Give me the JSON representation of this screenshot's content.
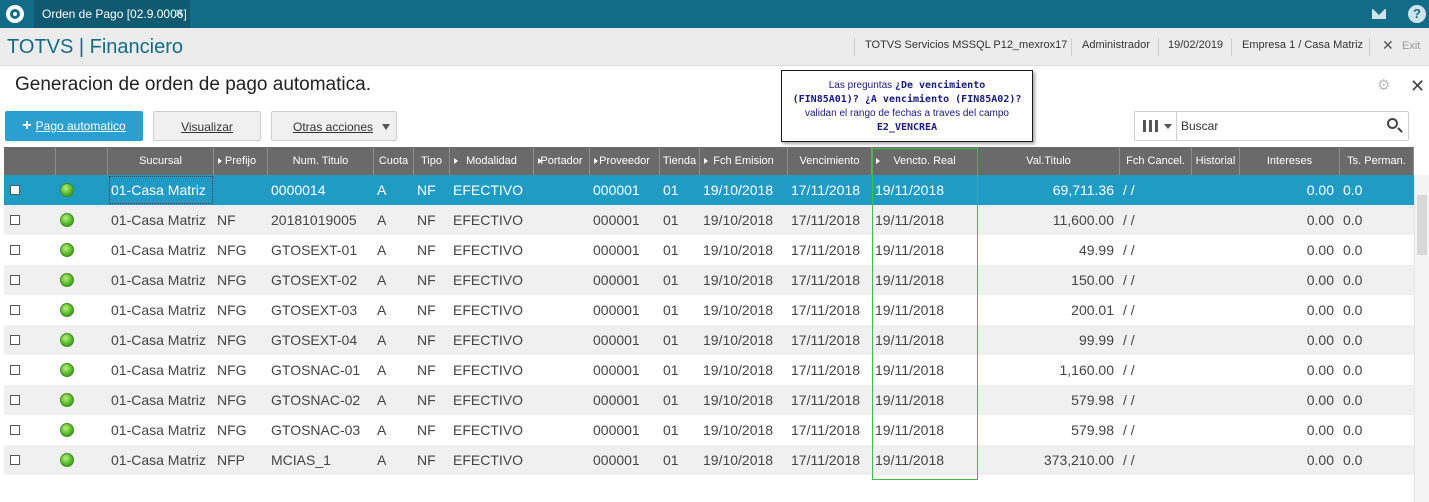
{
  "topbar": {
    "tab_label": "Orden de Pago [02.9.0006]",
    "tab_close": "✕",
    "help_glyph": "?",
    "brand_color": "#136c87"
  },
  "header": {
    "brand": "TOTVS | Financiero",
    "server": "TOTVS Servicios MSSQL P12_mexrox17",
    "user": "Administrador",
    "date": "19/02/2019",
    "company": "Empresa 1 / Casa Matriz",
    "exit_label": "Exit",
    "exit_glyph": "✕"
  },
  "page": {
    "title": "Generacion de orden de pago automatica.",
    "gear_glyph": "⚙",
    "close_glyph": "✕"
  },
  "toolbar": {
    "primary_plus": "+",
    "primary_label": "Pago automatico",
    "visualizar_label": "Visualizar",
    "otras_label": "Otras acciones",
    "primary_color": "#2a9fd0"
  },
  "search": {
    "placeholder": "Buscar"
  },
  "tooltip": {
    "line1_prefix": "Las preguntas ",
    "line1_bold": "¿De vencimiento",
    "line2_bold": "(FIN85A01)? ¿A vencimiento (FIN85A02)?",
    "line3": "validan el rango de fechas a traves del campo",
    "line4_bold": "E2_VENCREA"
  },
  "grid": {
    "columns": [
      "Sucursal",
      "Prefijo",
      "Num. Titulo",
      "Cuota",
      "Tipo",
      "Modalidad",
      "Portador",
      "Proveedor",
      "Tienda",
      "Fch Emision",
      "Vencimiento",
      "Vencto. Real",
      "Val.Titulo",
      "Fch Cancel.",
      "Historial",
      "Intereses",
      "Ts. Perman."
    ],
    "selected_row_color": "#209cc4",
    "status_color": "#57b82b",
    "rows": [
      {
        "sucursal": "01-Casa Matriz",
        "prefijo": "",
        "num": "0000014",
        "cuota": "A",
        "tipo": "NF",
        "modalidad": "EFECTIVO",
        "portador": "",
        "proveedor": "000001",
        "tienda": "01",
        "emision": "19/10/2018",
        "venc": "17/11/2018",
        "vreal": "19/11/2018",
        "valor": "69,711.36",
        "cancel": "/ /",
        "historial": "",
        "intereses": "0.00",
        "perman": "0.0"
      },
      {
        "sucursal": "01-Casa Matriz",
        "prefijo": "NF",
        "num": "20181019005",
        "cuota": "A",
        "tipo": "NF",
        "modalidad": "EFECTIVO",
        "portador": "",
        "proveedor": "000001",
        "tienda": "01",
        "emision": "19/10/2018",
        "venc": "17/11/2018",
        "vreal": "19/11/2018",
        "valor": "11,600.00",
        "cancel": "/ /",
        "historial": "",
        "intereses": "0.00",
        "perman": "0.0"
      },
      {
        "sucursal": "01-Casa Matriz",
        "prefijo": "NFG",
        "num": "GTOSEXT-01",
        "cuota": "A",
        "tipo": "NF",
        "modalidad": "EFECTIVO",
        "portador": "",
        "proveedor": "000001",
        "tienda": "01",
        "emision": "19/10/2018",
        "venc": "17/11/2018",
        "vreal": "19/11/2018",
        "valor": "49.99",
        "cancel": "/ /",
        "historial": "",
        "intereses": "0.00",
        "perman": "0.0"
      },
      {
        "sucursal": "01-Casa Matriz",
        "prefijo": "NFG",
        "num": "GTOSEXT-02",
        "cuota": "A",
        "tipo": "NF",
        "modalidad": "EFECTIVO",
        "portador": "",
        "proveedor": "000001",
        "tienda": "01",
        "emision": "19/10/2018",
        "venc": "17/11/2018",
        "vreal": "19/11/2018",
        "valor": "150.00",
        "cancel": "/ /",
        "historial": "",
        "intereses": "0.00",
        "perman": "0.0"
      },
      {
        "sucursal": "01-Casa Matriz",
        "prefijo": "NFG",
        "num": "GTOSEXT-03",
        "cuota": "A",
        "tipo": "NF",
        "modalidad": "EFECTIVO",
        "portador": "",
        "proveedor": "000001",
        "tienda": "01",
        "emision": "19/10/2018",
        "venc": "17/11/2018",
        "vreal": "19/11/2018",
        "valor": "200.01",
        "cancel": "/ /",
        "historial": "",
        "intereses": "0.00",
        "perman": "0.0"
      },
      {
        "sucursal": "01-Casa Matriz",
        "prefijo": "NFG",
        "num": "GTOSEXT-04",
        "cuota": "A",
        "tipo": "NF",
        "modalidad": "EFECTIVO",
        "portador": "",
        "proveedor": "000001",
        "tienda": "01",
        "emision": "19/10/2018",
        "venc": "17/11/2018",
        "vreal": "19/11/2018",
        "valor": "99.99",
        "cancel": "/ /",
        "historial": "",
        "intereses": "0.00",
        "perman": "0.0"
      },
      {
        "sucursal": "01-Casa Matriz",
        "prefijo": "NFG",
        "num": "GTOSNAC-01",
        "cuota": "A",
        "tipo": "NF",
        "modalidad": "EFECTIVO",
        "portador": "",
        "proveedor": "000001",
        "tienda": "01",
        "emision": "19/10/2018",
        "venc": "17/11/2018",
        "vreal": "19/11/2018",
        "valor": "1,160.00",
        "cancel": "/ /",
        "historial": "",
        "intereses": "0.00",
        "perman": "0.0"
      },
      {
        "sucursal": "01-Casa Matriz",
        "prefijo": "NFG",
        "num": "GTOSNAC-02",
        "cuota": "A",
        "tipo": "NF",
        "modalidad": "EFECTIVO",
        "portador": "",
        "proveedor": "000001",
        "tienda": "01",
        "emision": "19/10/2018",
        "venc": "17/11/2018",
        "vreal": "19/11/2018",
        "valor": "579.98",
        "cancel": "/ /",
        "historial": "",
        "intereses": "0.00",
        "perman": "0.0"
      },
      {
        "sucursal": "01-Casa Matriz",
        "prefijo": "NFG",
        "num": "GTOSNAC-03",
        "cuota": "A",
        "tipo": "NF",
        "modalidad": "EFECTIVO",
        "portador": "",
        "proveedor": "000001",
        "tienda": "01",
        "emision": "19/10/2018",
        "venc": "17/11/2018",
        "vreal": "19/11/2018",
        "valor": "579.98",
        "cancel": "/ /",
        "historial": "",
        "intereses": "0.00",
        "perman": "0.0"
      },
      {
        "sucursal": "01-Casa Matriz",
        "prefijo": "NFP",
        "num": "MCIAS_1",
        "cuota": "A",
        "tipo": "NF",
        "modalidad": "EFECTIVO",
        "portador": "",
        "proveedor": "000001",
        "tienda": "01",
        "emision": "19/10/2018",
        "venc": "17/11/2018",
        "vreal": "19/11/2018",
        "valor": "373,210.00",
        "cancel": "/ /",
        "historial": "",
        "intereses": "0.00",
        "perman": "0.0"
      }
    ]
  }
}
